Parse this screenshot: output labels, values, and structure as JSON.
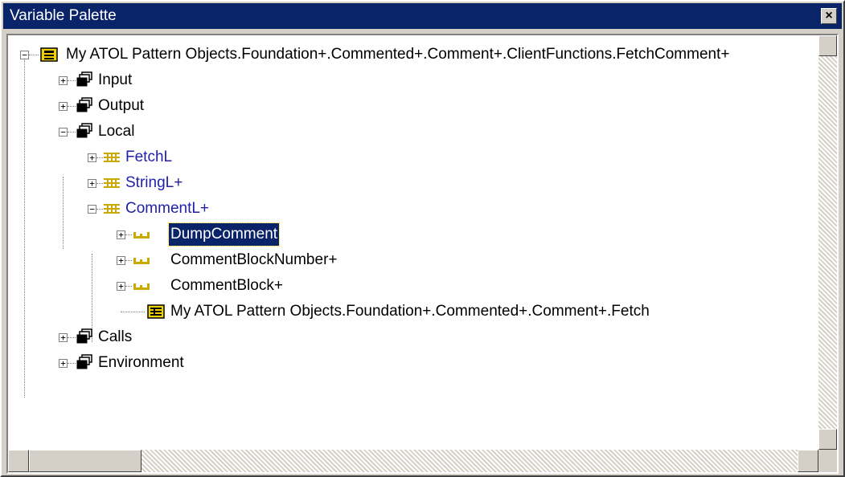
{
  "window": {
    "title": "Variable Palette",
    "close_label": "×"
  },
  "tree": {
    "root": {
      "label": "My ATOL Pattern Objects.Foundation+.Commented+.Comment+.ClientFunctions.FetchComment+",
      "expanded": true,
      "icon": "class-icon"
    },
    "nodes": [
      {
        "label": "Input",
        "icon": "folder-stack-icon",
        "expanded": false
      },
      {
        "label": "Output",
        "icon": "folder-stack-icon",
        "expanded": false
      },
      {
        "label": "Local",
        "icon": "folder-stack-icon",
        "expanded": true
      },
      {
        "label": "FetchL",
        "icon": "structure-icon",
        "expanded": false
      },
      {
        "label": "StringL+",
        "icon": "structure-icon",
        "expanded": false
      },
      {
        "label": "CommentL+",
        "icon": "structure-icon",
        "expanded": true
      },
      {
        "label": "DumpComment",
        "icon": "field-icon",
        "expanded": false,
        "selected": true
      },
      {
        "label": "CommentBlockNumber+",
        "icon": "field-icon",
        "expanded": false
      },
      {
        "label": "CommentBlock+",
        "icon": "field-icon",
        "expanded": false
      },
      {
        "label": "My ATOL Pattern Objects.Foundation+.Commented+.Comment+.Fetch",
        "icon": "table-icon"
      },
      {
        "label": "Calls",
        "icon": "folder-stack-icon",
        "expanded": false
      },
      {
        "label": "Environment",
        "icon": "folder-stack-icon",
        "expanded": false
      }
    ]
  },
  "colors": {
    "title_bar": "#0a246a",
    "link_text": "#1f1fa8",
    "selection": "#0a246a",
    "icon_yellow": "#f0d000"
  }
}
